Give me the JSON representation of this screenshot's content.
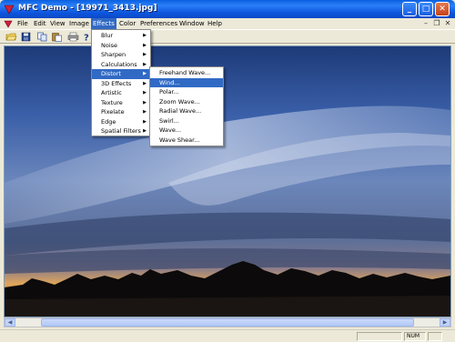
{
  "window": {
    "title": "MFC Demo - [19971_3413.jpg]",
    "controls": {
      "minimize": "_",
      "maximize": "□",
      "close": "✕"
    }
  },
  "menubar": {
    "items": [
      {
        "label": "File"
      },
      {
        "label": "Edit"
      },
      {
        "label": "View"
      },
      {
        "label": "Image"
      },
      {
        "label": "Effects",
        "active": true
      },
      {
        "label": "Color"
      },
      {
        "label": "Preferences"
      },
      {
        "label": "Window"
      },
      {
        "label": "Help"
      }
    ],
    "mdi_controls": {
      "minimize": "–",
      "restore": "❐",
      "close": "✕"
    }
  },
  "toolbar": {
    "icons": [
      "open-folder-icon",
      "save-icon",
      "copy-icon",
      "paste-icon",
      "print-icon",
      "help-icon"
    ]
  },
  "effects_menu": {
    "items": [
      {
        "label": "Blur",
        "submenu": true
      },
      {
        "label": "Noise",
        "submenu": true
      },
      {
        "label": "Sharpen",
        "submenu": true
      },
      {
        "label": "Calculations",
        "submenu": true
      },
      {
        "label": "Distort",
        "submenu": true,
        "highlighted": true
      },
      {
        "label": "3D Effects",
        "submenu": true
      },
      {
        "label": "Artistic",
        "submenu": true
      },
      {
        "label": "Texture",
        "submenu": true
      },
      {
        "label": "Pixelate",
        "submenu": true
      },
      {
        "label": "Edge",
        "submenu": true
      },
      {
        "label": "Spatial Filters",
        "submenu": true
      }
    ]
  },
  "distort_menu": {
    "items": [
      {
        "label": "Freehand Wave..."
      },
      {
        "label": "Wind...",
        "highlighted": true
      },
      {
        "label": "Polar..."
      },
      {
        "label": "Zoom Wave..."
      },
      {
        "label": "Radial Wave..."
      },
      {
        "label": "Swirl..."
      },
      {
        "label": "Wave..."
      },
      {
        "label": "Wave Shear..."
      }
    ]
  },
  "statusbar": {
    "num": "NUM"
  },
  "colors": {
    "title_bar": "#0b54dc",
    "menu_highlight": "#316ac5",
    "chrome": "#ece9d8"
  }
}
